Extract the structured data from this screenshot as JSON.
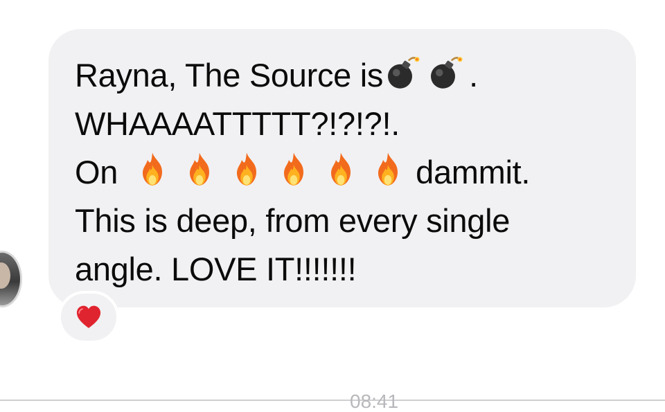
{
  "message": {
    "line1_text": "Rayna, The Source is",
    "line1_end": ".",
    "line2": "WHAAAATTTTT?!?!?!.",
    "line3_start": "On",
    "line3_end": "dammit.",
    "line4": "This is deep, from every single",
    "line5": "angle. LOVE IT!!!!!!!",
    "bomb_count": 2,
    "fire_count": 6,
    "bomb_icon": "bomb-emoji",
    "fire_icon": "fire-emoji",
    "bubble_color": "#f1f1f3",
    "text_color": "#0b0b0b"
  },
  "reaction": {
    "icon": "red-heart-emoji",
    "color": "#e0242f"
  },
  "sender": {
    "avatar_icon": "user-avatar"
  },
  "footer": {
    "timestamp": "08:41"
  }
}
